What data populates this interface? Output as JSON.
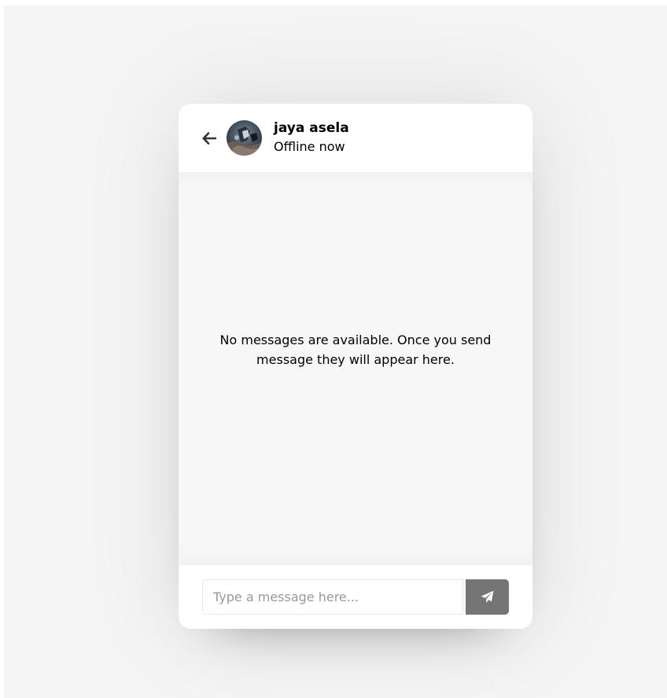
{
  "header": {
    "user_name": "jaya asela",
    "user_status": "Offline now",
    "back_icon": "arrow-left-icon",
    "avatar_alt": "jaya asela profile photo"
  },
  "chat": {
    "empty_message": "No messages are available. Once you send message they will appear here."
  },
  "composer": {
    "input_value": "",
    "input_placeholder": "Type a message here...",
    "send_icon": "paper-plane-icon"
  },
  "colors": {
    "page_background": "#f5f5f5",
    "card_background": "#ffffff",
    "chat_background": "#f7f7f7",
    "send_button": "#757575",
    "text": "#000000"
  }
}
